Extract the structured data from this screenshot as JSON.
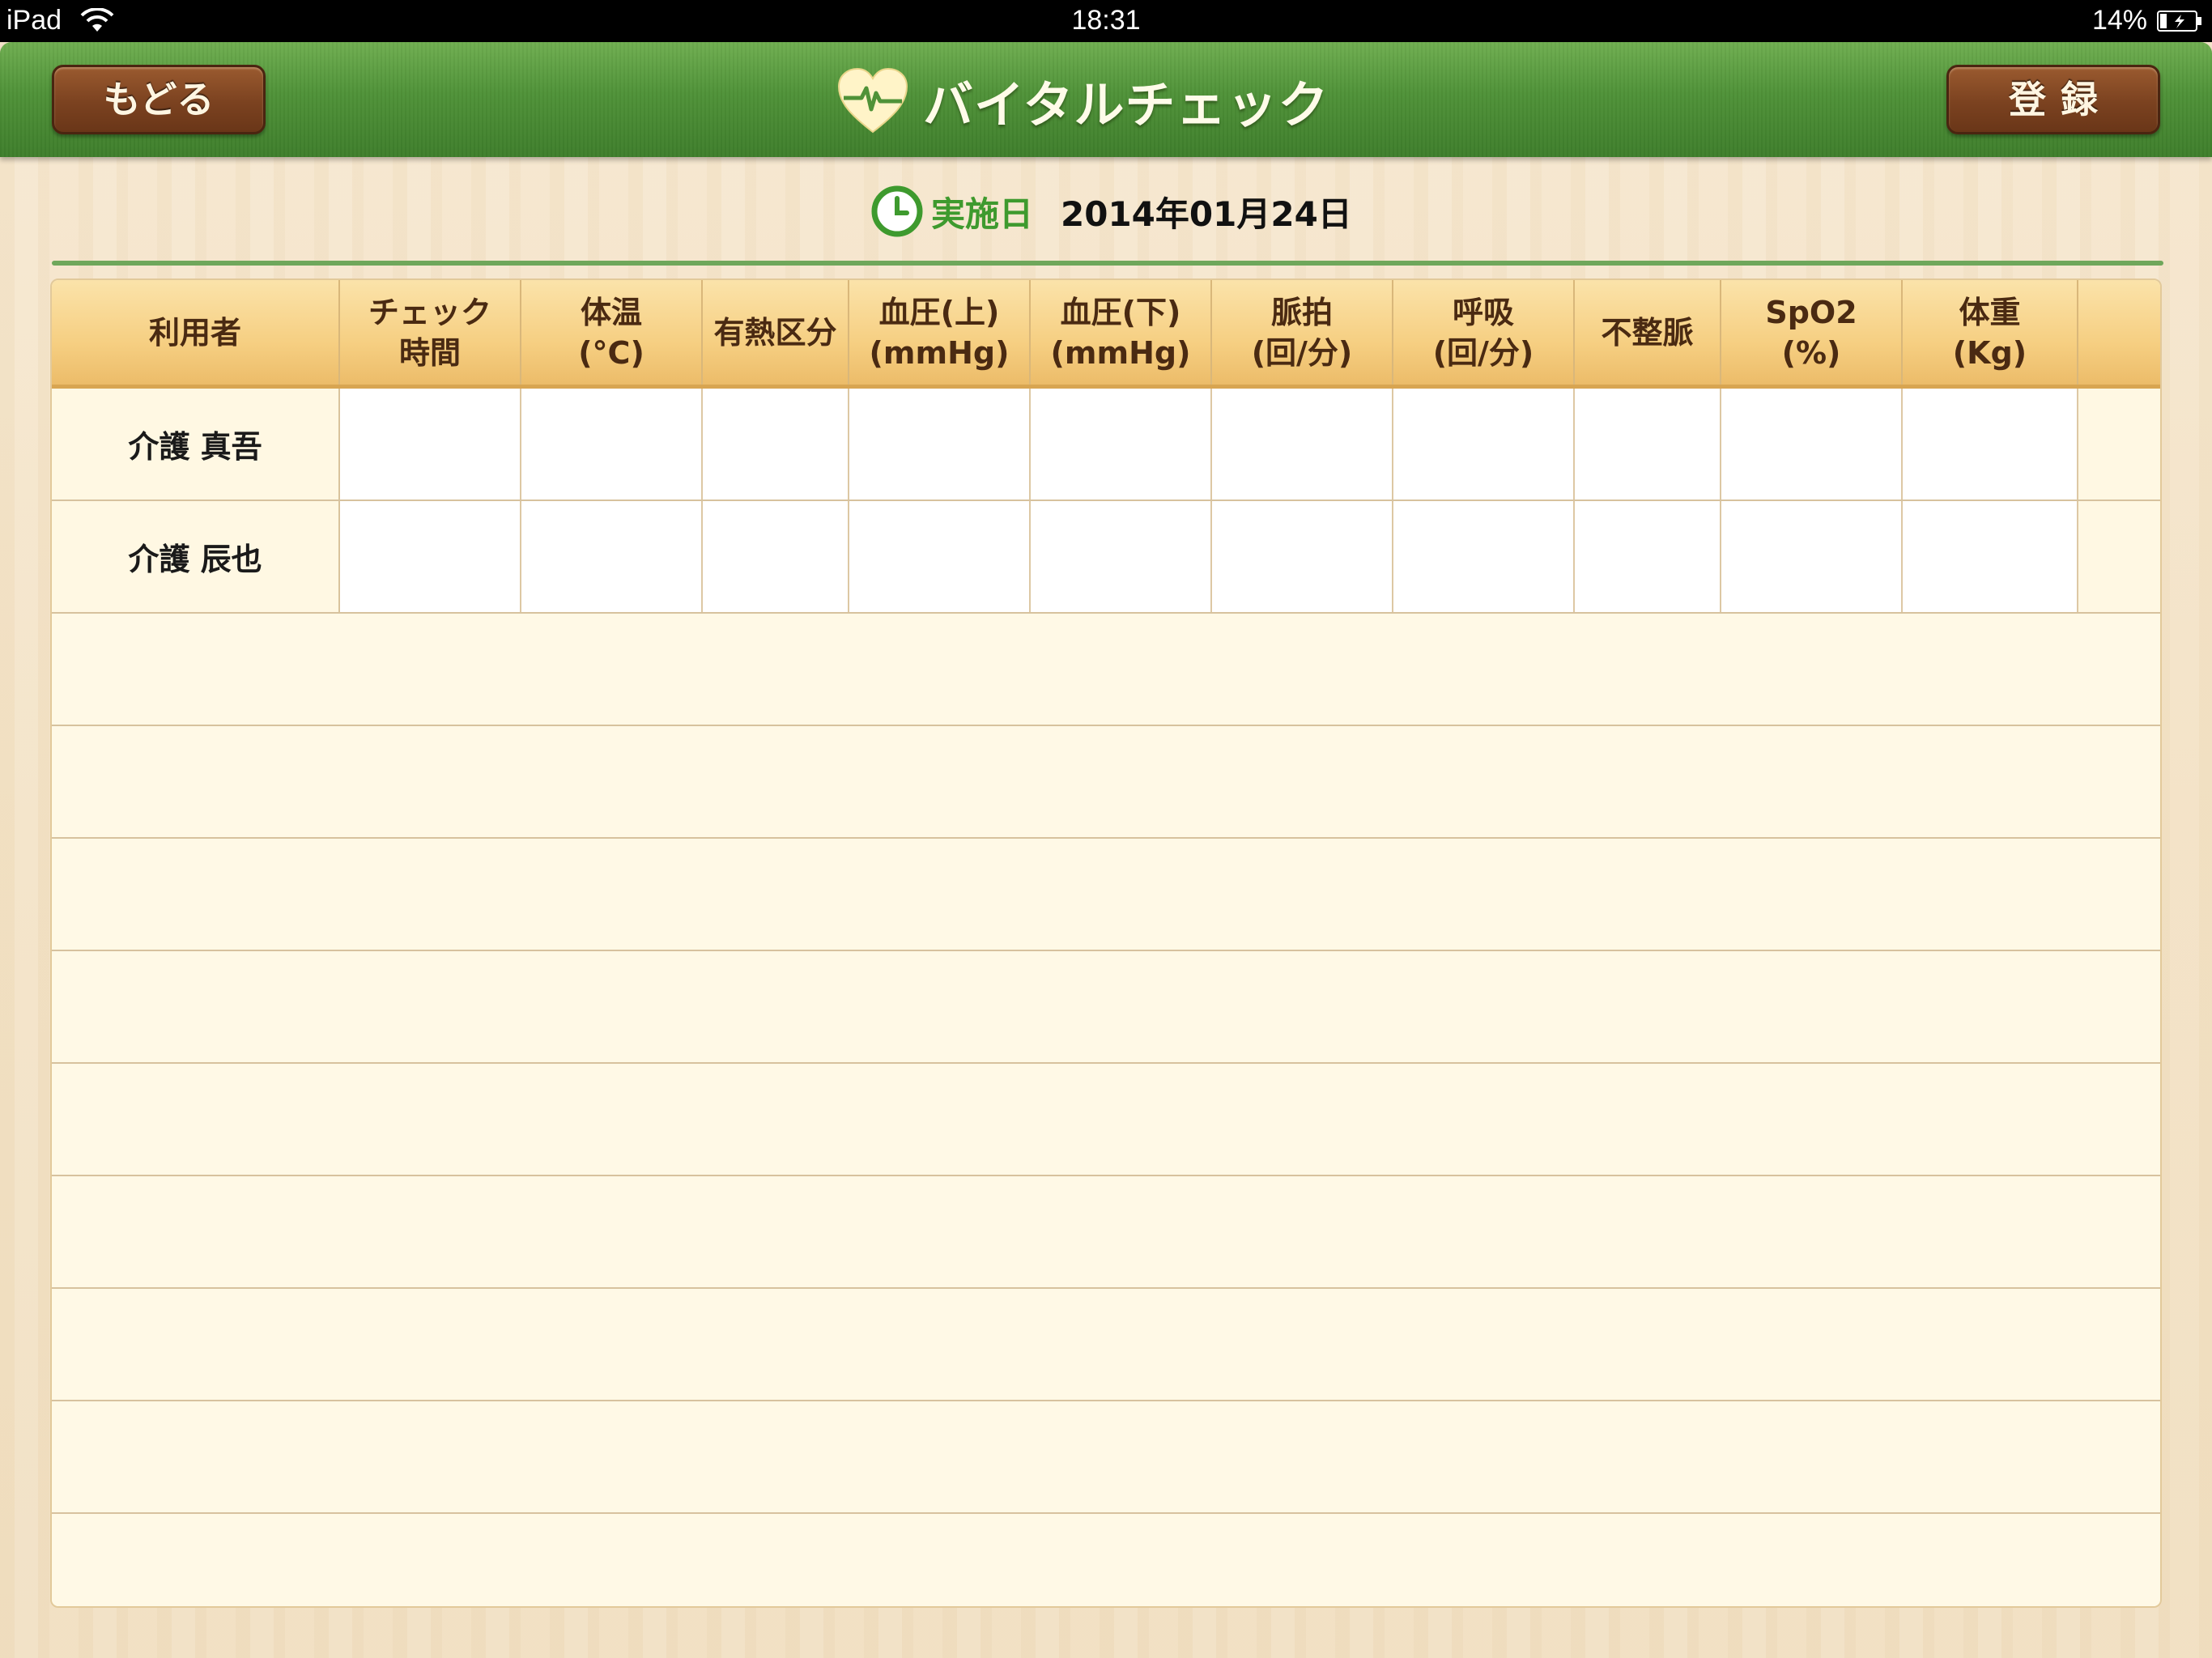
{
  "status_bar": {
    "device": "iPad",
    "time": "18:31",
    "battery": "14%"
  },
  "nav": {
    "back_label": "もどる",
    "title": "バイタルチェック",
    "register_label": "登録"
  },
  "date": {
    "label": "実施日",
    "value": "2014年01月24日"
  },
  "table": {
    "columns": [
      "利用者",
      "チェック\n時間",
      "体温\n(°C)",
      "有熱区分",
      "血圧(上)\n(mmHg)",
      "血圧(下)\n(mmHg)",
      "脈拍\n(回/分)",
      "呼吸\n(回/分)",
      "不整脈",
      "SpO2\n(%)",
      "体重\n(Kg)"
    ],
    "rows": [
      {
        "name": "介護 真吾"
      },
      {
        "name": "介護 辰也"
      }
    ]
  },
  "colors": {
    "nav_green": "#4f9238",
    "button_brown": "#7b4220",
    "header_orange": "#f6cf82",
    "date_green": "#3e9a2e"
  },
  "icons": [
    "wifi-icon",
    "battery-icon",
    "heart-pulse-icon",
    "clock-icon"
  ]
}
